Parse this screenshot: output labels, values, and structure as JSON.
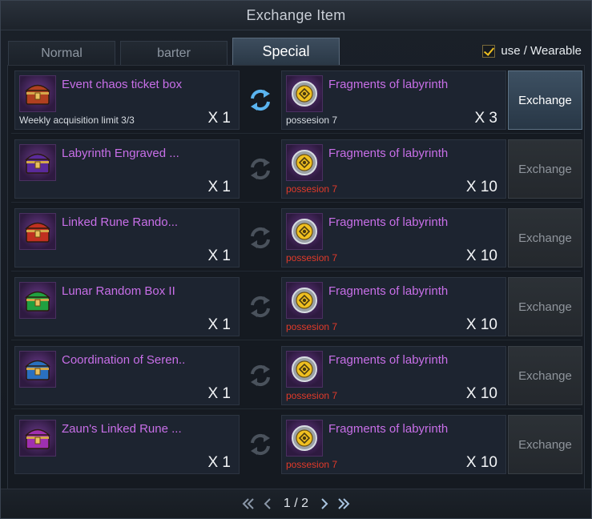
{
  "window": {
    "title": "Exchange Item"
  },
  "tabs": [
    {
      "label": "Normal"
    },
    {
      "label": "barter"
    },
    {
      "label": "Special"
    }
  ],
  "filter": {
    "label": "use / Wearable",
    "checked": true
  },
  "rows": [
    {
      "item": {
        "name": "Event chaos ticket box",
        "note": "Weekly acquisition limit 3/3",
        "qty": "X 1",
        "icon": "treasure-chest-icon",
        "color": "#b04020"
      },
      "cost": {
        "name": "Fragments of labyrinth",
        "possession": "possesion 7",
        "qty": "X 3",
        "icon": "labyrinth-fragment-icon",
        "affordable": true
      },
      "button": "Exchange",
      "active": true
    },
    {
      "item": {
        "name": "Labyrinth Engraved ...",
        "note": "",
        "qty": "X 1",
        "icon": "backpack-icon",
        "color": "#5a2a9a"
      },
      "cost": {
        "name": "Fragments of labyrinth",
        "possession": "possesion 7",
        "qty": "X 10",
        "icon": "labyrinth-fragment-icon",
        "affordable": false
      },
      "button": "Exchange",
      "active": false
    },
    {
      "item": {
        "name": "Linked Rune Rando...",
        "note": "",
        "qty": "X 1",
        "icon": "rune-box-icon",
        "color": "#c03020"
      },
      "cost": {
        "name": "Fragments of labyrinth",
        "possession": "possesion 7",
        "qty": "X 10",
        "icon": "labyrinth-fragment-icon",
        "affordable": false
      },
      "button": "Exchange",
      "active": false
    },
    {
      "item": {
        "name": "Lunar Random Box II",
        "note": "",
        "qty": "X 1",
        "icon": "lunar-box-icon",
        "color": "#20a040"
      },
      "cost": {
        "name": "Fragments of labyrinth",
        "possession": "possesion 7",
        "qty": "X 10",
        "icon": "labyrinth-fragment-icon",
        "affordable": false
      },
      "button": "Exchange",
      "active": false
    },
    {
      "item": {
        "name": "Coordination of Seren..",
        "note": "",
        "qty": "X 1",
        "icon": "serenity-box-icon",
        "color": "#2a70c0"
      },
      "cost": {
        "name": "Fragments of labyrinth",
        "possession": "possesion 7",
        "qty": "X 10",
        "icon": "labyrinth-fragment-icon",
        "affordable": false
      },
      "button": "Exchange",
      "active": false
    },
    {
      "item": {
        "name": "Zaun's Linked Rune ...",
        "note": "",
        "qty": "X 1",
        "icon": "zaun-rune-box-icon",
        "color": "#a030b0"
      },
      "cost": {
        "name": "Fragments of labyrinth",
        "possession": "possesion 7",
        "qty": "X 10",
        "icon": "labyrinth-fragment-icon",
        "affordable": false
      },
      "button": "Exchange",
      "active": false
    }
  ],
  "pager": {
    "current": "1",
    "separator": "/",
    "total": "2"
  }
}
